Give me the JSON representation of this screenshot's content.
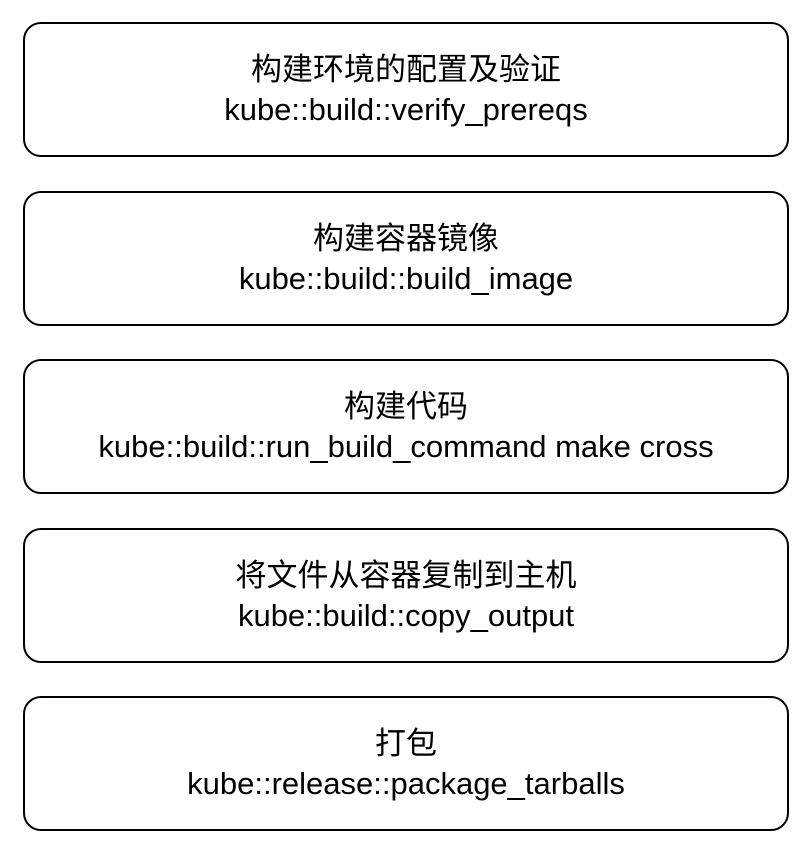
{
  "steps": [
    {
      "title": "构建环境的配置及验证",
      "function": "kube::build::verify_prereqs"
    },
    {
      "title": "构建容器镜像",
      "function": "kube::build::build_image"
    },
    {
      "title": "构建代码",
      "function": "kube::build::run_build_command make cross"
    },
    {
      "title": "将文件从容器复制到主机",
      "function": "kube::build::copy_output"
    },
    {
      "title": "打包",
      "function": "kube::release::package_tarballs"
    }
  ]
}
